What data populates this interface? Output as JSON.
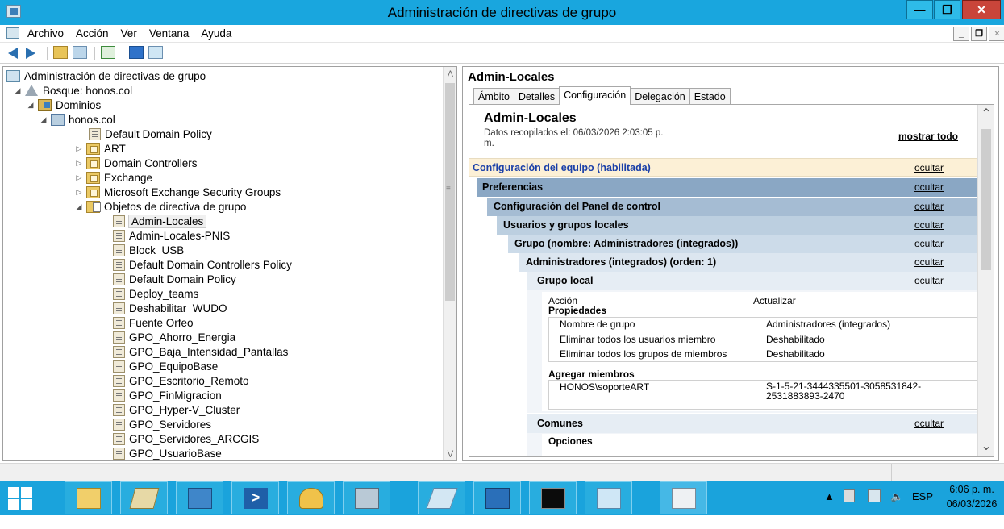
{
  "window": {
    "title": "Administración de directivas de grupo",
    "minimize": "—",
    "maximize": "❐",
    "close": "✕"
  },
  "menu": [
    "Archivo",
    "Acción",
    "Ver",
    "Ventana",
    "Ayuda"
  ],
  "tree": {
    "root": "Administración de directivas de grupo",
    "forest": "Bosque: honos.col",
    "domains": "Dominios",
    "domain": "honos.col",
    "default_domain_policy": "Default Domain Policy",
    "ous": [
      "ART",
      "Domain Controllers",
      "Exchange",
      "Microsoft Exchange Security Groups"
    ],
    "gpo_container": "Objetos de directiva de grupo",
    "gpos": [
      "Admin-Locales",
      "Admin-Locales-PNIS",
      "Block_USB",
      "Default Domain Controllers Policy",
      "Default Domain Policy",
      "Deploy_teams",
      "Deshabilitar_WUDO",
      "Fuente Orfeo",
      "GPO_Ahorro_Energia",
      "GPO_Baja_Intensidad_Pantallas",
      "GPO_EquipoBase",
      "GPO_Escritorio_Remoto",
      "GPO_FinMigracion",
      "GPO_Hyper-V_Cluster",
      "GPO_Servidores",
      "GPO_Servidores_ARCGIS",
      "GPO_UsuarioBase"
    ],
    "selected": "Admin-Locales"
  },
  "details": {
    "title": "Admin-Locales",
    "tabs": [
      "Ámbito",
      "Detalles",
      "Configuración",
      "Delegación",
      "Estado"
    ],
    "active_tab": "Configuración"
  },
  "report": {
    "title": "Admin-Locales",
    "date_line1": "Datos recopilados el: 06/03/2026 2:03:05 p.",
    "date_line2": "m.",
    "show_all": "mostrar todo",
    "hide": "ocultar",
    "computer_config": "Configuración del equipo (habilitada)",
    "preferences": "Preferencias",
    "control_panel": "Configuración del Panel de control",
    "local_users": "Usuarios y grupos locales",
    "group": "Grupo (nombre: Administradores (integrados))",
    "admins": "Administradores (integrados) (orden: 1)",
    "local_group": "Grupo local",
    "action_label": "Acción",
    "action_value": "Actualizar",
    "properties": "Propiedades",
    "props": [
      {
        "k": "Nombre de grupo",
        "v": "Administradores (integrados)"
      },
      {
        "k": "Eliminar todos los usuarios miembro",
        "v": "Deshabilitado"
      },
      {
        "k": "Eliminar todos los grupos de miembros",
        "v": "Deshabilitado"
      }
    ],
    "add_members": "Agregar miembros",
    "member_name": "HONOS\\soporteART",
    "member_sid1": "S-1-5-21-3444335501-3058531842-",
    "member_sid2": "2531883893-2470",
    "common": "Comunes",
    "options": "Opciones"
  },
  "taskbar": {
    "tray_lang": "ESP",
    "time": "6:06 p. m.",
    "date": "06/03/2026"
  },
  "colors": {
    "titlebar": "#19a6de",
    "taskbar": "#1aa3dc",
    "computer_config_bg": "#fcf0d6",
    "preferences_bg": "#8aa7c4",
    "level2_bg": "#a5bcd3",
    "level3_bg": "#bccfe0",
    "level4_bg": "#ccdbe9",
    "level5_bg": "#dce6f0",
    "level6_bg": "#e6edf4",
    "link": "#000000"
  }
}
